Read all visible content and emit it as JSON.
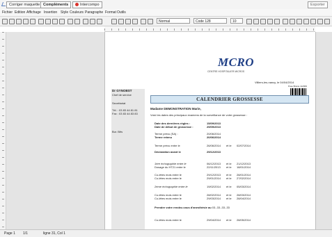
{
  "tabs": [
    {
      "label": "Corriger maquette"
    },
    {
      "label": "Compléments"
    },
    {
      "label": "Intercompo"
    }
  ],
  "export_label": "Exporter",
  "menu": [
    "Fichier",
    "Edition",
    "Affichage",
    "Insertion",
    "Style",
    "Couleurs",
    "Paragraphe",
    "Format",
    "Outils"
  ],
  "toolbar": {
    "style_value": "Normal",
    "font_value": "Code 128",
    "size_value": "10"
  },
  "header": {
    "logo": "MCRO",
    "hospital": "CENTRE HOSPITALIER MICROS",
    "place_date": "Villiers-les-nancy,  le 04/04/2014",
    "barcode_caption": "Pose Branie 112909"
  },
  "side": {
    "doctor": "Dr GYNOBST",
    "role": "Chef de service",
    "secretariat": "Secrétariat",
    "tel": "Tél. :   03 83 44 81 81",
    "fax": "Fax :   03 83 44 83 83",
    "bur": "Bur. Bës"
  },
  "calendar": {
    "title": "CALENDRIER GROSSESSE",
    "patient": "Madame DEMONSTRATION Marie,",
    "intro": "Voici les dates des principaux examens de la surveillance de votre grossesse :",
    "lmp_label": "Date des dernières règles :",
    "lmp_value": "15/09/2013",
    "start_label": "Date de début de grossesse :",
    "start_value": "29/09/2013",
    "term_label": "Terme prévu (SA) :",
    "term_value": "20/06/2014",
    "term2_label": "Terme retenu",
    "term2_value": "20/06/2014",
    "leave_label": "Terme prévu entre le",
    "leave_d1": "26/06/2014",
    "leave_et": "et le",
    "leave_d2": "02/07/2014",
    "decl_label": "Déclaration avant le",
    "decl_value": "29/12/2013",
    "echo1_label": "1ère échographie entre le",
    "echo1_d1": "06/12/2013",
    "echo1_et": "et le",
    "echo1_d2": "21/12/2013",
    "tri_label": "Dosage du HT21 entre le",
    "tri_d1": "22/11/2013",
    "tri_et": "et le",
    "tri_d2": "18/01/2014",
    "c1_label": "Co-lètes mois entre le",
    "c1_d1": "29/12/2013",
    "c1_et": "et le",
    "c1_d2": "28/01/2014",
    "c2_label": "Co-lètes mois entre le",
    "c2_d1": "29/01/2014",
    "c2_et": "et le",
    "c2_d2": "27/02/2014",
    "echo2_label": "2ème échographie entre le",
    "echo2_d1": "19/02/2014",
    "echo2_et": "et le",
    "echo2_d2": "05/03/2014",
    "c3_label": "Co-lètes mois entre le",
    "c3_d1": "28/02/2014",
    "c3_et": "et le",
    "c3_d2": "28/03/2014",
    "c4_label": "Co-lètes mois entre le",
    "c4_d1": "29/03/2014",
    "c4_et": "et le",
    "c4_d2": "28/04/2014",
    "anesth": "Prendre votre rendez-vous d'anesthésie au ",
    "anesth_tel": "03.-33.-33.-33",
    "c5_label": "Co-lètes mois entre le",
    "c5_d1": "29/04/2014",
    "c5_et": "et le",
    "c5_d2": "28/05/2014"
  },
  "status": {
    "page": "Page 1",
    "pages": "1/1",
    "line": "ligne 31, Col 1"
  }
}
